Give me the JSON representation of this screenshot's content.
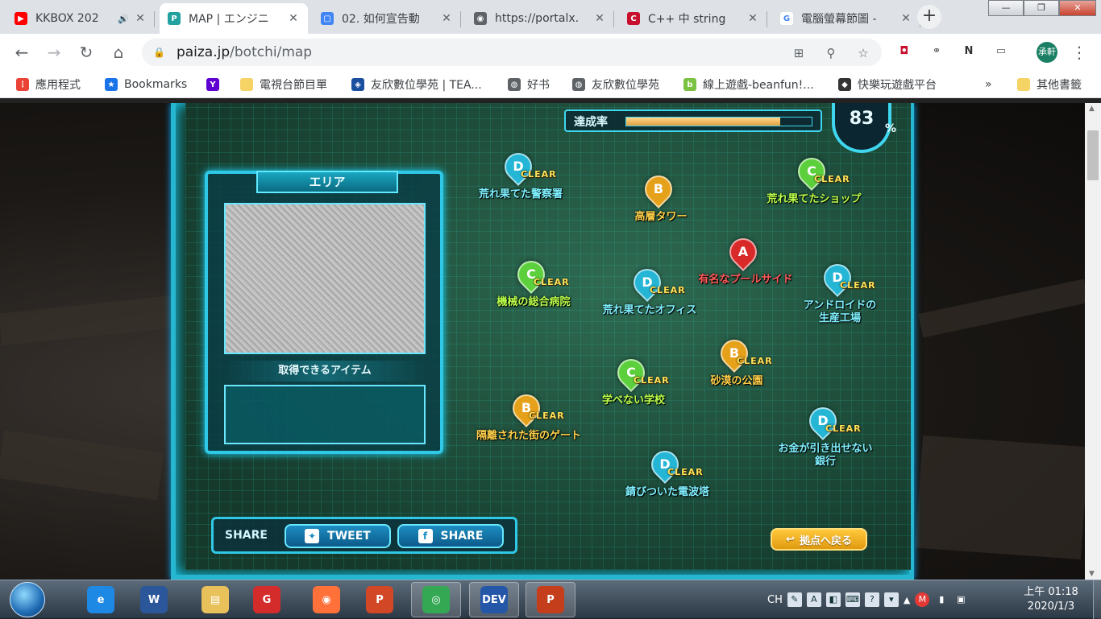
{
  "browser": {
    "tabs": [
      {
        "title": "KKBOX 202",
        "favicon_color": "#ff0000",
        "favicon": "▶",
        "audio": true,
        "active": false
      },
      {
        "title": "MAP | エンジニ",
        "favicon_color": "#23a0a0",
        "favicon": "P",
        "active": true
      },
      {
        "title": "02. 如何宣告動",
        "favicon_color": "#4285f4",
        "favicon": "▢",
        "active": false
      },
      {
        "title": "https://portalx.",
        "favicon_color": "#5f6368",
        "favicon": "◉",
        "active": false
      },
      {
        "title": "C++ 中 string",
        "favicon_color": "#c8102e",
        "favicon": "C",
        "active": false
      },
      {
        "title": "電腦螢幕節圖 -",
        "favicon_color": "#ffffff",
        "favicon": "G",
        "active": false
      }
    ],
    "window_controls": {
      "minimize": "—",
      "maximize": "❐",
      "close": "✕"
    },
    "url_host": "paiza.jp",
    "url_path": "/botchi/map",
    "profile_label": "承軒",
    "bookmarks": [
      {
        "label": "應用程式",
        "icon": "apps-icon",
        "color": "#ea4335"
      },
      {
        "label": "Bookmarks",
        "icon": "star-icon",
        "color": "#1a73e8"
      },
      {
        "label": "",
        "icon": "yahoo-icon",
        "color": "#5f01d1"
      },
      {
        "label": "電視台節目單",
        "icon": "folder-icon",
        "color": "#f6d365"
      },
      {
        "label": "友欣數位學苑 | TEA...",
        "icon": "site-icon",
        "color": "#1a4fa0"
      },
      {
        "label": "好书",
        "icon": "globe-icon",
        "color": "#5f6368"
      },
      {
        "label": "友欣數位學苑",
        "icon": "globe-icon",
        "color": "#5f6368"
      },
      {
        "label": "線上遊戲-beanfun!...",
        "icon": "beanfun-icon",
        "color": "#7cc242"
      },
      {
        "label": "快樂玩遊戲平台",
        "icon": "game-icon",
        "color": "#333333"
      },
      {
        "label": "其他書籤",
        "icon": "folder-icon",
        "color": "#f6d365"
      }
    ],
    "more_bookmarks": "»"
  },
  "game": {
    "progress_label": "達成率",
    "progress_value": 83,
    "percent_sign": "%",
    "area_title": "エリア",
    "items_label": "取得できるアイテム",
    "share_label": "SHARE",
    "tweet_label": "TWEET",
    "share_button_label": "SHARE",
    "back_label": "拠点へ戻る",
    "clear_text": "CLEAR",
    "markers": [
      {
        "rank": "D",
        "name": "荒れ果てた警察署",
        "cleared": true
      },
      {
        "rank": "B",
        "name": "高層タワー",
        "cleared": false
      },
      {
        "rank": "C",
        "name": "荒れ果てたショップ",
        "cleared": true
      },
      {
        "rank": "A",
        "name": "有名なプールサイド",
        "cleared": false
      },
      {
        "rank": "C",
        "name": "機械の総合病院",
        "cleared": true
      },
      {
        "rank": "D",
        "name": "荒れ果てたオフィス",
        "cleared": true
      },
      {
        "rank": "D",
        "name": "アンドロイドの\n生産工場",
        "cleared": true
      },
      {
        "rank": "B",
        "name": "砂漠の公園",
        "cleared": true
      },
      {
        "rank": "C",
        "name": "学べない学校",
        "cleared": true
      },
      {
        "rank": "B",
        "name": "隔離された街のゲート",
        "cleared": true
      },
      {
        "rank": "D",
        "name": "お金が引き出せない\n銀行",
        "cleared": true
      },
      {
        "rank": "D",
        "name": "錆びついた電波塔",
        "cleared": true
      }
    ]
  },
  "taskbar": {
    "apps": [
      {
        "name": "ie",
        "label": "e",
        "color": "#1e88e5",
        "open": false
      },
      {
        "name": "word",
        "label": "W",
        "color": "#2b579a",
        "open": false
      },
      {
        "name": "explorer",
        "label": "▤",
        "color": "#e8c15a",
        "open": false
      },
      {
        "name": "garena",
        "label": "G",
        "color": "#d42b2b",
        "open": false
      },
      {
        "name": "firefox",
        "label": "◉",
        "color": "#ff7139",
        "open": false
      },
      {
        "name": "powerpoint-viewer",
        "label": "P",
        "color": "#d24726",
        "open": false
      },
      {
        "name": "chrome",
        "label": "◎",
        "color": "#34a853",
        "open": true
      },
      {
        "name": "dev-cpp",
        "label": "DEV",
        "color": "#2457a8",
        "open": true
      },
      {
        "name": "powerpoint",
        "label": "P",
        "color": "#c43e1c",
        "open": true
      }
    ],
    "input_lang": "CH",
    "clock_time": "上午 01:18",
    "clock_date": "2020/1/3"
  }
}
